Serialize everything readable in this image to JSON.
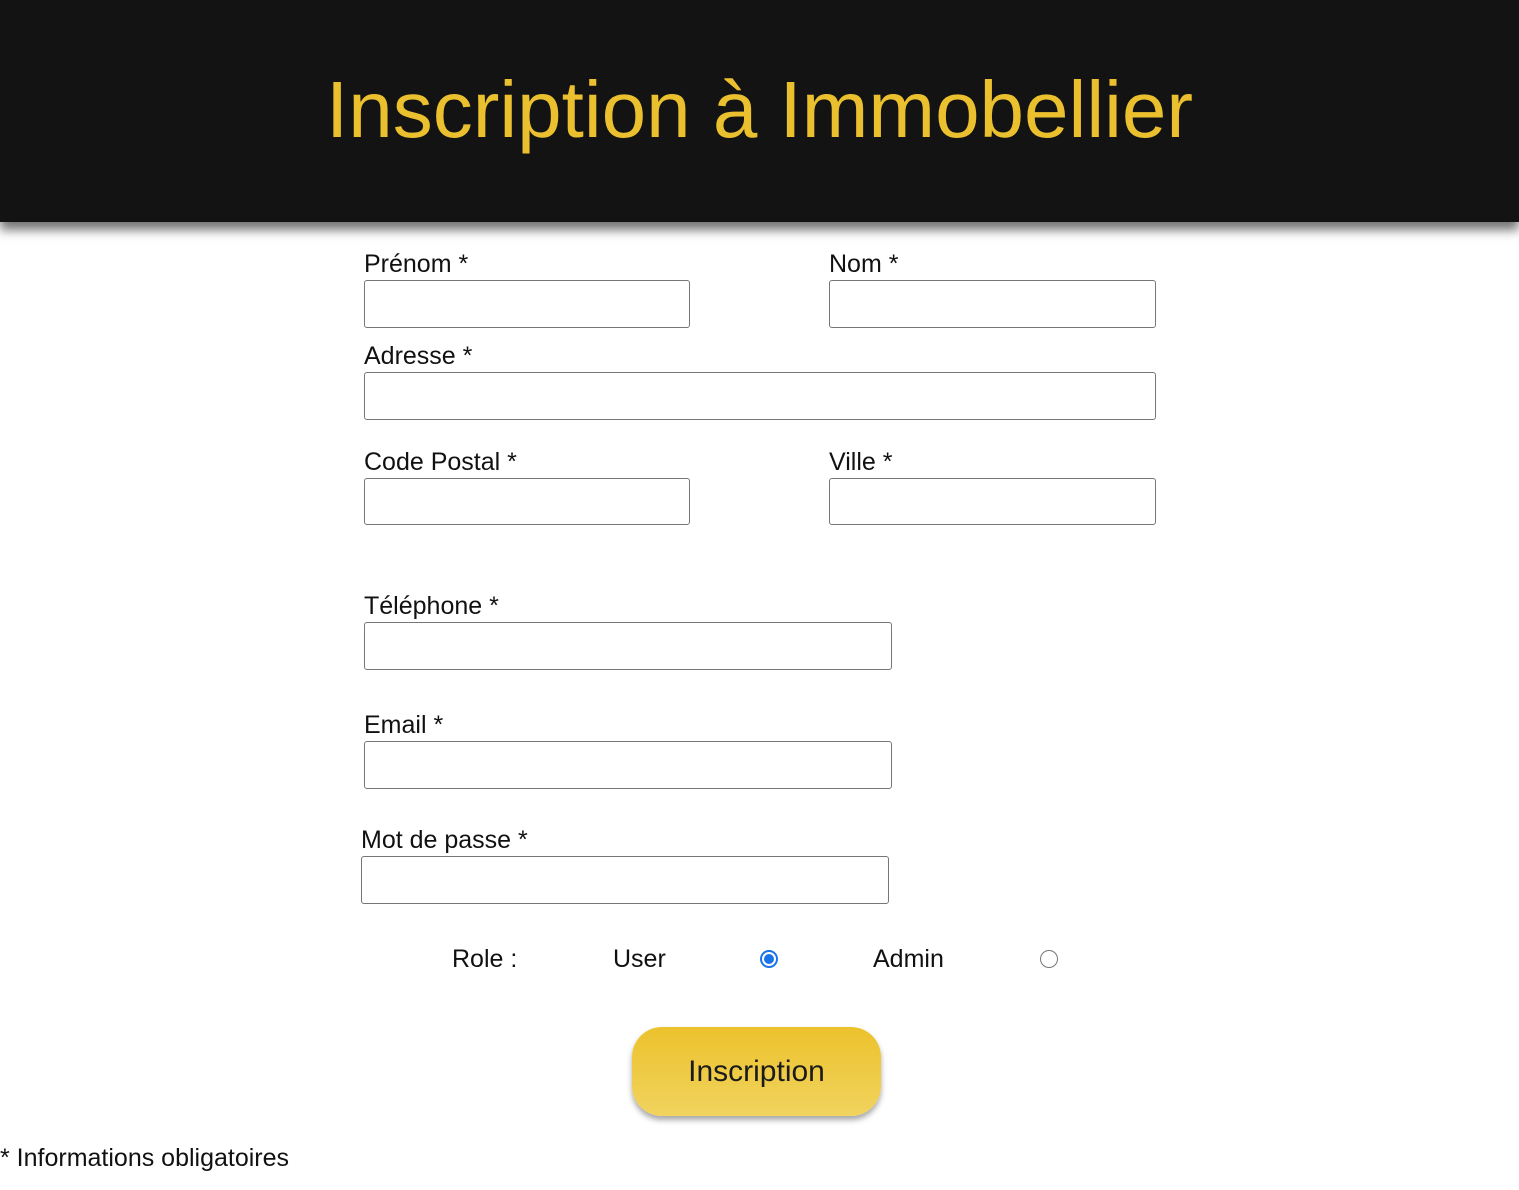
{
  "header": {
    "title": "Inscription à Immobellier"
  },
  "form": {
    "prenom_label": "Prénom *",
    "prenom_value": "",
    "nom_label": "Nom *",
    "nom_value": "",
    "adresse_label": "Adresse *",
    "adresse_value": "",
    "code_postal_label": "Code Postal *",
    "code_postal_value": "",
    "ville_label": "Ville *",
    "ville_value": "",
    "telephone_label": "Téléphone *",
    "telephone_value": "",
    "email_label": "Email *",
    "email_value": "",
    "password_label": "Mot de passe *",
    "password_value": "",
    "role": {
      "label": "Role :",
      "options": [
        {
          "label": "User",
          "checked": true
        },
        {
          "label": "Admin",
          "checked": false
        }
      ]
    },
    "submit_label": "Inscription"
  },
  "footnote": "* Informations obligatoires",
  "colors": {
    "header_bg": "#131313",
    "accent": "#ebc02e",
    "radio_checked": "#1a73e8"
  }
}
